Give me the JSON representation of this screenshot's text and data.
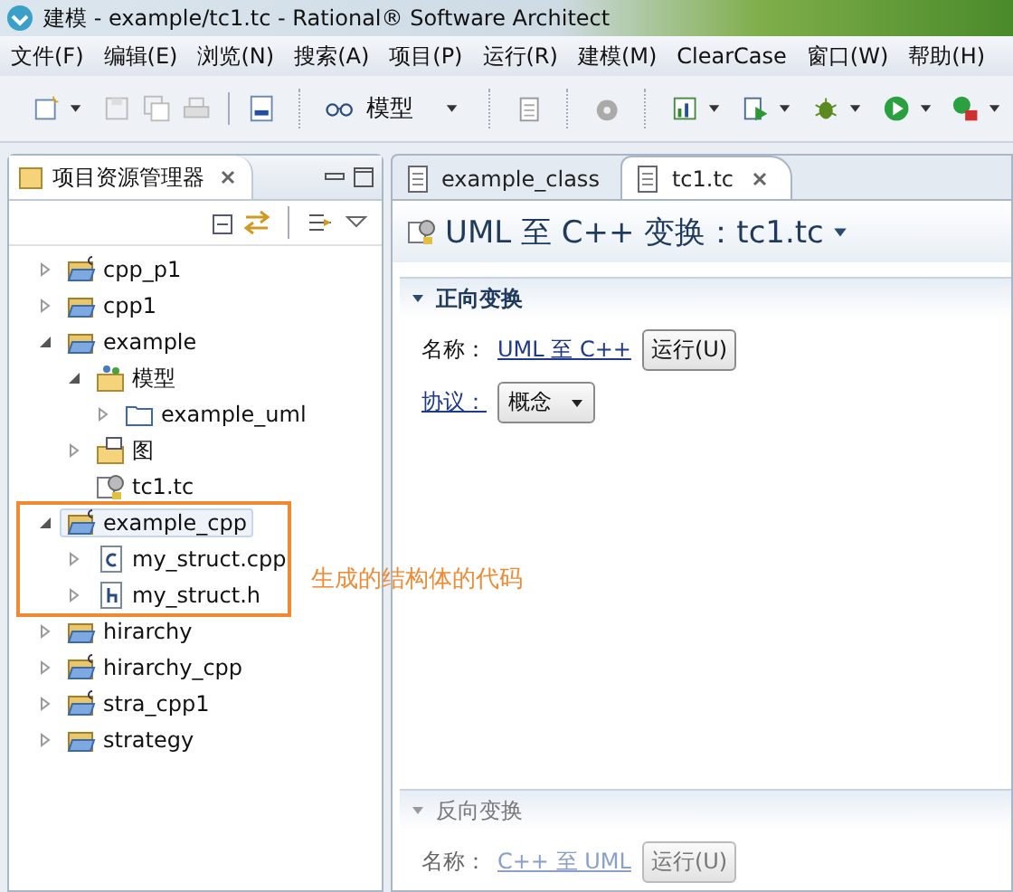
{
  "window": {
    "title": "建模 - example/tc1.tc - Rational® Software Architect"
  },
  "menu": [
    "文件(F)",
    "编辑(E)",
    "浏览(N)",
    "搜索(A)",
    "项目(P)",
    "运行(R)",
    "建模(M)",
    "ClearCase",
    "窗口(W)",
    "帮助(H)"
  ],
  "toolbar": {
    "perspective": "模型"
  },
  "explorer": {
    "title": "项目资源管理器",
    "tree": [
      {
        "label": "cpp_p1",
        "kind": "cpp_project",
        "expanded": false,
        "selected": false
      },
      {
        "label": "cpp1",
        "kind": "project",
        "expanded": false,
        "selected": false
      },
      {
        "label": "example",
        "kind": "project",
        "expanded": true,
        "selected": false,
        "children": [
          {
            "label": "模型",
            "kind": "model",
            "expanded": true,
            "selected": false,
            "children": [
              {
                "label": "example_uml",
                "kind": "folder",
                "expanded": false,
                "selected": false
              }
            ]
          },
          {
            "label": "图",
            "kind": "diagrams",
            "expanded": false,
            "selected": false
          },
          {
            "label": "tc1.tc",
            "kind": "tc",
            "selected": false
          }
        ]
      },
      {
        "label": "example_cpp",
        "kind": "cpp_project",
        "expanded": true,
        "selected": true,
        "children": [
          {
            "label": "my_struct.cpp",
            "kind": "c_file",
            "expanded": false,
            "selected": false
          },
          {
            "label": "my_struct.h",
            "kind": "h_file",
            "expanded": false,
            "selected": false
          }
        ]
      },
      {
        "label": "hirarchy",
        "kind": "project",
        "expanded": false,
        "selected": false
      },
      {
        "label": "hirarchy_cpp",
        "kind": "cpp_project",
        "expanded": false,
        "selected": false
      },
      {
        "label": "stra_cpp1",
        "kind": "cpp_project",
        "expanded": false,
        "selected": false
      },
      {
        "label": "strategy",
        "kind": "project",
        "expanded": false,
        "selected": false
      }
    ]
  },
  "editor": {
    "tabs": [
      {
        "label": "example_class",
        "selected": false
      },
      {
        "label": "tc1.tc",
        "selected": true
      }
    ],
    "heading": "UML 至 C++ 变换：tc1.tc",
    "sections": [
      {
        "title": "正向变换",
        "disabled": false,
        "name_label": "名称：",
        "name_link": "UML 至 C++",
        "run_button": "运行(U)",
        "protocol_label": "协议：",
        "protocol_value": "概念"
      },
      {
        "title": "反向变换",
        "disabled": true,
        "name_label": "名称：",
        "name_link": "C++ 至 UML",
        "run_button": "运行(U)"
      }
    ]
  },
  "annotation": {
    "text": "生成的结构体的代码"
  }
}
